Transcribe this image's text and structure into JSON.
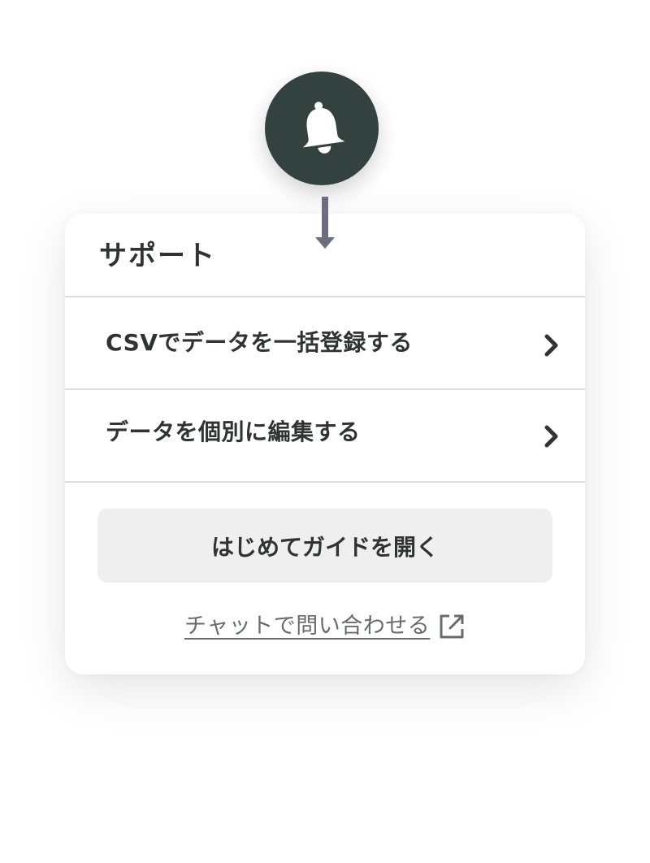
{
  "support_panel": {
    "title": "サポート",
    "menu_items": [
      {
        "label": "CSVでデータを一括登録する",
        "icon": "chevron-right-icon"
      },
      {
        "label": "データを個別に編集する",
        "icon": "chevron-right-icon"
      }
    ],
    "guide_button_label": "はじめてガイドを開く",
    "chat_link_label": "チャットで問い合わせる",
    "chat_link_icon": "external-link-icon"
  },
  "bell_button": {
    "icon": "bell-icon"
  },
  "colors": {
    "bell_background": "#33423f",
    "text_primary": "#2f3432",
    "text_secondary": "#666c6a",
    "guide_button_background": "#efefef",
    "divider": "#dddddd",
    "pointer_arrow": "#6b6e7e"
  }
}
